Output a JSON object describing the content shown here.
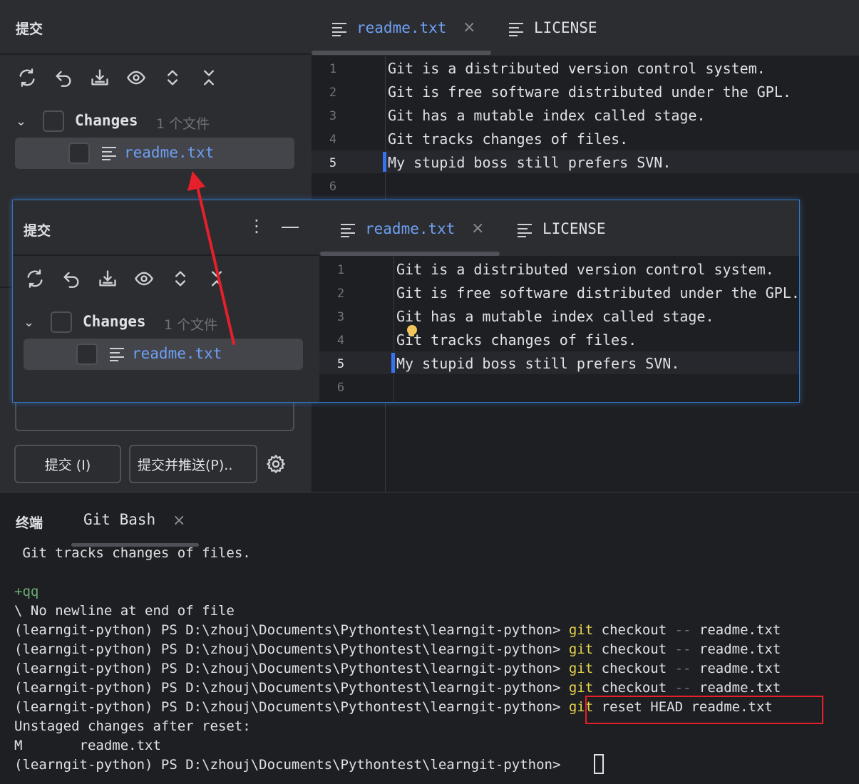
{
  "commit_panel": {
    "title": "提交",
    "changes_label": "Changes",
    "file_count": "1 个文件",
    "file_name": "readme.txt",
    "commit_button": "提交 (I)",
    "commit_push_button": "提交并推送(P)..",
    "toolbar_icons": [
      "refresh-icon",
      "rollback-icon",
      "shelve-icon",
      "eye-icon",
      "expand-icon",
      "collapse-icon"
    ]
  },
  "editor": {
    "tabs": [
      {
        "label": "readme.txt",
        "active": true
      },
      {
        "label": "LICENSE",
        "active": false
      }
    ],
    "lines": [
      {
        "num": "1",
        "text": "Git is a distributed version control system."
      },
      {
        "num": "2",
        "text": "Git is free software distributed under the GPL."
      },
      {
        "num": "3",
        "text": "Git has a mutable index called stage."
      },
      {
        "num": "4",
        "text": "Git tracks changes of files."
      },
      {
        "num": "5",
        "text": "My stupid boss still prefers SVN."
      },
      {
        "num": "6",
        "text": ""
      }
    ]
  },
  "terminal": {
    "title": "终端",
    "tab": "Git Bash",
    "lines": {
      "l0": " Git tracks changes of files.",
      "l1": "",
      "l2": "+qq",
      "l3": "\\ No newline at end of file",
      "prompt": "(learngit-python) PS D:\\zhouj\\Documents\\Pythontest\\learngit-python> ",
      "git": "git",
      "checkout": " checkout ",
      "dashes": "--",
      "file": " readme.txt",
      "reset": " reset HEAD readme.txt",
      "unstaged": "Unstaged changes after reset:",
      "modified": "M       readme.txt"
    }
  },
  "colors": {
    "accent_blue": "#6f9ff5",
    "annotation_red": "#e5202a",
    "git_yellow": "#e8d44d"
  }
}
